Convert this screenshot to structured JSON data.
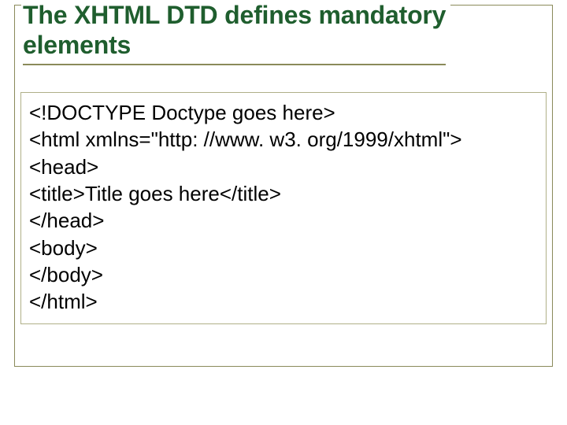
{
  "title_line1": "The XHTML DTD defines mandatory",
  "title_line2": "elements",
  "code": {
    "l1": "<!DOCTYPE Doctype goes here>",
    "l2": "<html xmlns=\"http: //www. w3. org/1999/xhtml\">",
    "l3": "<head>",
    "l4": "<title>Title goes here</title>",
    "l5": "</head>",
    "l6": "<body>",
    "l7": "</body>",
    "l8": "</html>"
  }
}
